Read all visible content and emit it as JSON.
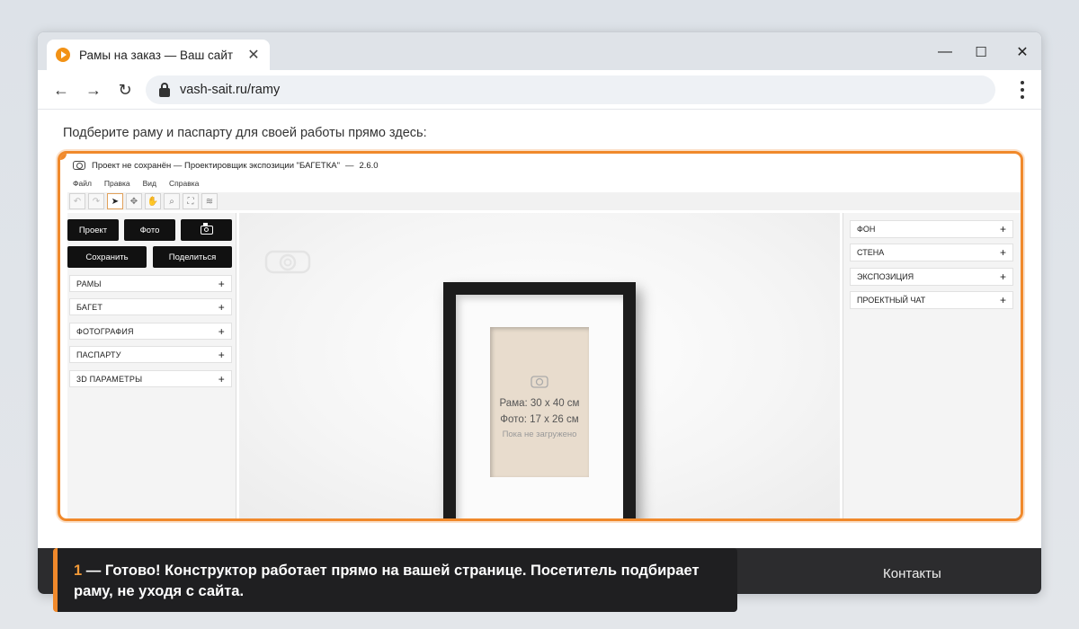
{
  "browser": {
    "tab_title": "Рамы на заказ — Ваш сайт",
    "url": "vash-sait.ru/ramy",
    "accent_color": "#f0892b"
  },
  "page": {
    "intro": "Подберите раму и паспарту для своей работы прямо здесь:",
    "footer_link": "Контакты"
  },
  "app": {
    "title": "Проект не сохранён — Проектировщик экспозиции \"БАГЕТКА\"",
    "version": "2.6.0",
    "menu": [
      "Файл",
      "Правка",
      "Вид",
      "Справка"
    ],
    "toolbar_icons": [
      "undo-icon",
      "redo-icon",
      "cursor-icon",
      "move-icon",
      "hand-icon",
      "zoom-icon",
      "fit-icon",
      "layers-icon"
    ],
    "left": {
      "btn_project": "Проект",
      "btn_photo": "Фото",
      "btn_save": "Сохранить",
      "btn_share": "Поделиться",
      "sections": [
        "РАМЫ",
        "БАГЕТ",
        "ФОТОГРАФИЯ",
        "ПАСПАРТУ",
        "3D ПАРАМЕТРЫ"
      ]
    },
    "right": {
      "sections": [
        "ФОН",
        "СТЕНА",
        "ЭКСПОЗИЦИЯ",
        "ПРОЕКТНЫЙ ЧАТ"
      ]
    },
    "preview": {
      "frame_size": "Рама: 30 x 40 см",
      "photo_size": "Фото: 17 x 26 см",
      "status": "Пока не загружено"
    }
  },
  "caption": {
    "number": "1",
    "text": " — Готово! Конструктор работает прямо на вашей странице. Посетитель подбирает раму, не уходя с сайта."
  }
}
